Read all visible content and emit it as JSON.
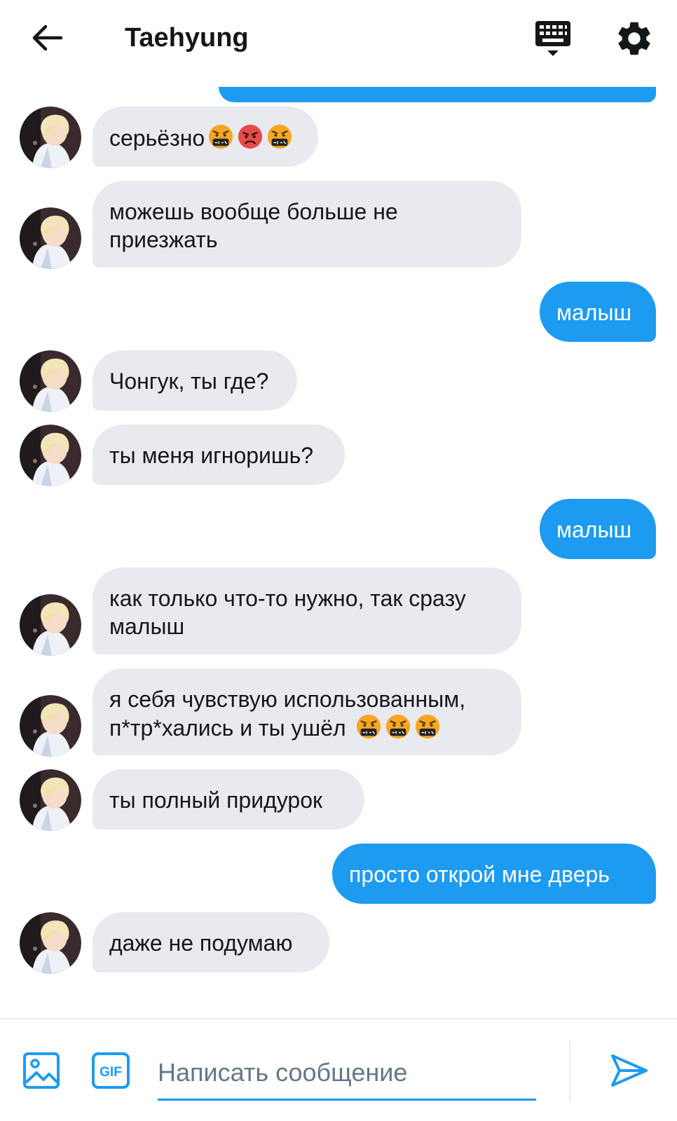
{
  "header": {
    "title": "Taehyung"
  },
  "colors": {
    "accent": "#1d9bf0",
    "incoming_bubble": "#e8eaef",
    "text": "#14171a",
    "placeholder": "#657786"
  },
  "messages": [
    {
      "from": "them",
      "text": "серьёзно",
      "emojis": [
        "cursing-face",
        "angry-face",
        "cursing-face"
      ]
    },
    {
      "from": "them",
      "text": "можешь вообще больше не\nприезжать",
      "emojis": []
    },
    {
      "from": "me",
      "text": "малыш",
      "emojis": []
    },
    {
      "from": "them",
      "text": "Чонгук, ты где?",
      "emojis": []
    },
    {
      "from": "them",
      "text": "ты меня игноришь?",
      "emojis": []
    },
    {
      "from": "me",
      "text": "малыш",
      "emojis": []
    },
    {
      "from": "them",
      "text": "как только что-то нужно, так сразу\nмалыш",
      "emojis": []
    },
    {
      "from": "them",
      "text": "я себя чувствую использованным,\nп*тр*хались и ты ушёл ",
      "emojis": [
        "cursing-face",
        "cursing-face",
        "cursing-face"
      ]
    },
    {
      "from": "them",
      "text": "ты полный придурок",
      "emojis": []
    },
    {
      "from": "me",
      "text": "просто открой мне дверь",
      "emojis": []
    },
    {
      "from": "them",
      "text": "даже не подумаю",
      "emojis": []
    }
  ],
  "composer": {
    "placeholder": "Написать сообщение",
    "gif_label": "GIF"
  },
  "icons": {
    "back": "arrow-left-icon",
    "keyboard": "keyboard-icon",
    "settings": "gear-icon",
    "image": "image-icon",
    "gif": "gif-icon",
    "send": "send-icon"
  }
}
